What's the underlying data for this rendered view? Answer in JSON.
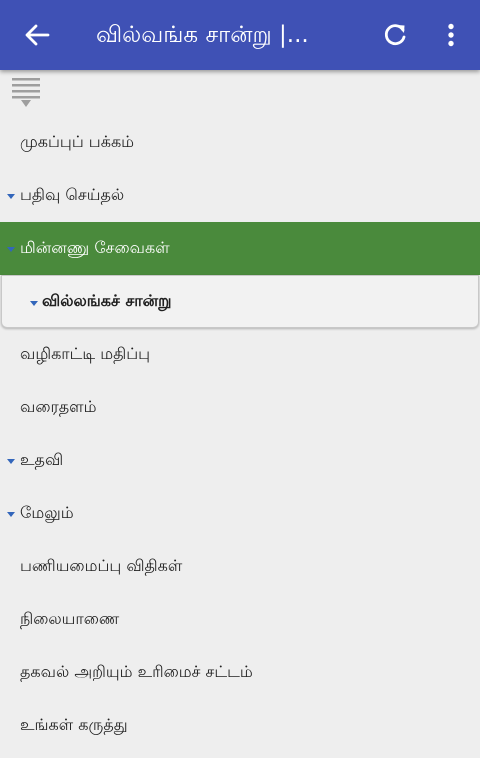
{
  "appbar": {
    "title": "வில்வங்க சான்று |...",
    "back_icon": "arrow-back-icon",
    "refresh_icon": "refresh-icon",
    "more_icon": "more-vert-icon",
    "color": "#3f51b5"
  },
  "menu_toggle_icon": "collapse-menu-icon",
  "nav": {
    "items": [
      {
        "label": "முகப்புப் பக்கம்",
        "expandable": false
      },
      {
        "label": "பதிவு செய்தல்",
        "expandable": true
      },
      {
        "label": "மின்னணு சேவைகள்",
        "expandable": true,
        "active": true
      },
      {
        "label": "வில்லங்கச் சான்று",
        "expandable": true,
        "sub": true
      },
      {
        "label": "வழிகாட்டி மதிப்பு",
        "expandable": false
      },
      {
        "label": "வரைதளம்",
        "expandable": false
      },
      {
        "label": "உதவி",
        "expandable": true
      },
      {
        "label": "மேலும்",
        "expandable": true
      },
      {
        "label": "பணியமைப்பு விதிகள்",
        "expandable": false
      },
      {
        "label": "நிலையாணை",
        "expandable": false
      },
      {
        "label": "தகவல் அறியும் உரிமைச் சட்டம்",
        "expandable": false
      },
      {
        "label": "உங்கள் கருத்து",
        "expandable": false
      }
    ],
    "active_color": "#4a8a3c",
    "caret_color": "#3366bb"
  }
}
